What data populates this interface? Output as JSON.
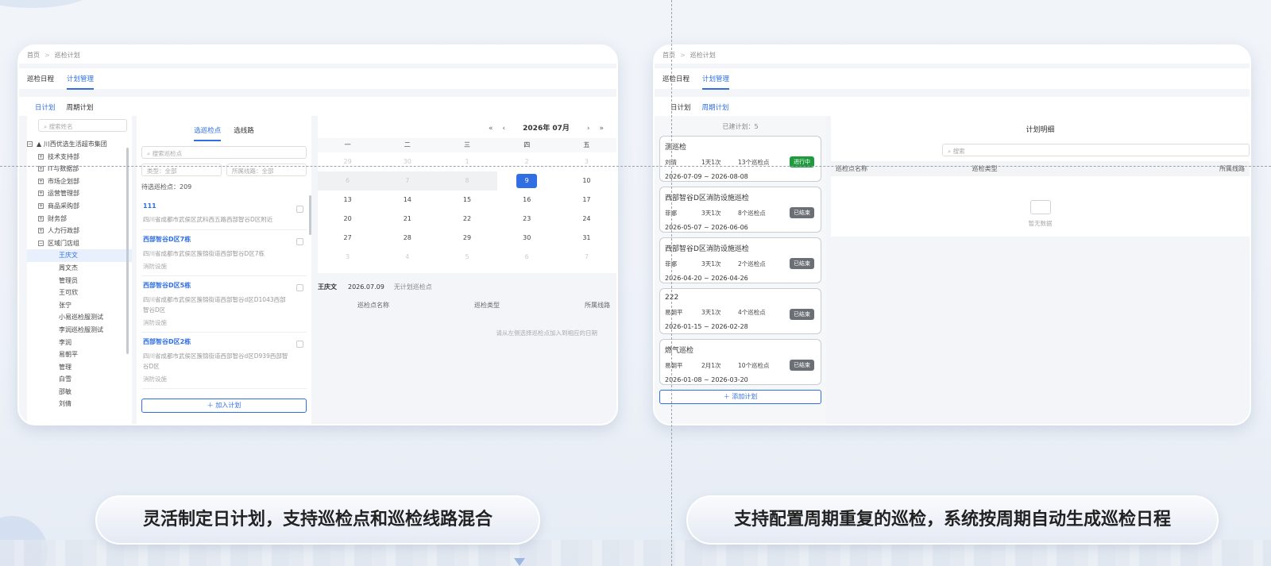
{
  "left_card": {
    "breadcrumb": [
      "首页",
      "巡检计划"
    ],
    "tabs": [
      "巡检日程",
      "计划管理"
    ],
    "subtabs": [
      "日计划",
      "周期计划"
    ],
    "tree": {
      "search_placeholder": "搜索姓名",
      "root": "川西优选生活超市集团",
      "departments": [
        "技术支持部",
        "IT与数据部",
        "市场企划部",
        "运营管理部",
        "商品采购部",
        "财务部",
        "人力行政部",
        "区域门店组"
      ],
      "people": [
        "王庆文",
        "周文杰",
        "管理员",
        "王可欣",
        "张宁",
        "小易巡检服测试",
        "李润巡检服测试",
        "李润",
        "易朝平",
        "管理",
        "白雪",
        "邵敏",
        "刘倩"
      ]
    },
    "points_panel": {
      "tabs": [
        "选巡检点",
        "选线路"
      ],
      "search_placeholder": "搜索巡检点",
      "filter_type": "类型：全部",
      "filter_route": "所属线路：全部",
      "count_label": "待选巡检点：209",
      "items": [
        {
          "name": "111",
          "addr": "四川省成都市武侯区武科西五路西部智谷D区附近",
          "type": ""
        },
        {
          "name": "西部智谷D区7栋",
          "addr": "四川省成都市武侯区簇锦街道西部智谷D区7栋",
          "type": "消防设施"
        },
        {
          "name": "西部智谷D区5栋",
          "addr": "四川省成都市武侯区簇锦街道西部智谷d区D1043西部智谷D区",
          "type": "消防设施"
        },
        {
          "name": "西部智谷D区2栋",
          "addr": "四川省成都市武侯区簇锦街道西部智谷d区D939西部智谷D区",
          "type": "消防设施"
        }
      ],
      "add_button": "加入计划"
    },
    "calendar": {
      "month_label": "2026年 07月",
      "nav": [
        "«",
        "‹",
        "›",
        "»"
      ],
      "weekdays": [
        "一",
        "二",
        "三",
        "四",
        "五"
      ],
      "rows": [
        [
          "29",
          "30",
          "1",
          "2",
          "3"
        ],
        [
          "6",
          "7",
          "8",
          "9",
          "10"
        ],
        [
          "13",
          "14",
          "15",
          "16",
          "17"
        ],
        [
          "20",
          "21",
          "22",
          "23",
          "24"
        ],
        [
          "27",
          "28",
          "29",
          "30",
          "31"
        ],
        [
          "3",
          "4",
          "5",
          "6",
          "7"
        ]
      ],
      "selected_day": "9"
    },
    "plan_detail": {
      "person": "王庆文",
      "date": "2026.07.09",
      "status": "无计划巡检点",
      "columns": [
        "巡检点名称",
        "巡检类型",
        "所属线路"
      ],
      "empty_hint": "请从左侧选择巡检点加入到相应的日期"
    }
  },
  "right_card": {
    "breadcrumb": [
      "首页",
      "巡检计划"
    ],
    "tabs": [
      "巡检日程",
      "计划管理"
    ],
    "subtabs": [
      "日计划",
      "周期计划"
    ],
    "built_count": "已建计划：5",
    "plans": [
      {
        "title": "测巡检",
        "person": "刘倩",
        "freq": "1天1次",
        "points": "13个巡检点",
        "status": "进行中",
        "range": "2026-07-09 ~ 2026-08-08"
      },
      {
        "title": "西部智谷D区消防设施巡检",
        "person": "菲娜",
        "freq": "3天1次",
        "points": "8个巡检点",
        "status": "已结束",
        "range": "2026-05-07 ~ 2026-06-06"
      },
      {
        "title": "西部智谷D区消防设施巡检",
        "person": "菲娜",
        "freq": "3天1次",
        "points": "2个巡检点",
        "status": "已结束",
        "range": "2026-04-20 ~ 2026-04-26"
      },
      {
        "title": "222",
        "person": "易朝平",
        "freq": "3天1次",
        "points": "4个巡检点",
        "status": "已结束",
        "range": "2026-01-15 ~ 2026-02-28"
      },
      {
        "title": "燃气巡检",
        "person": "易朝平",
        "freq": "2月1次",
        "points": "10个巡检点",
        "status": "已结束",
        "range": "2026-01-08 ~ 2026-03-20"
      }
    ],
    "add_button": "添加计划",
    "detail": {
      "title": "计划明细",
      "search_placeholder": "搜索",
      "columns": [
        "巡检点名称",
        "巡检类型",
        "所属线路"
      ],
      "empty": "暂无数据"
    }
  },
  "captions": {
    "left": "灵活制定日计划，支持巡检点和巡检线路混合",
    "right": "支持配置周期重复的巡检，系统按周期自动生成巡检日程"
  },
  "colors": {
    "accent": "#2f6fe3",
    "running": "#1e9b3c",
    "ended": "#6b6f76"
  }
}
